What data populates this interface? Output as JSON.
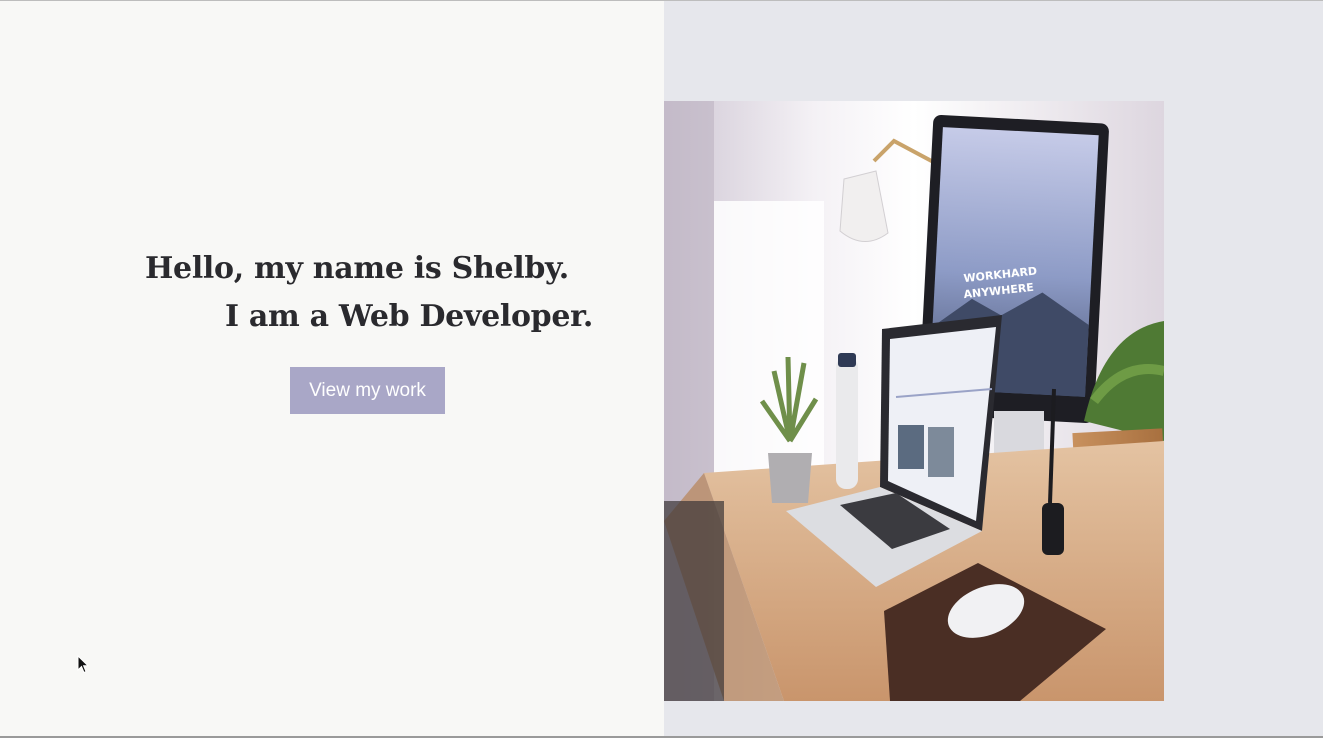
{
  "hero": {
    "greeting": "Hello, my name is Shelby.",
    "role": "I am a Web Developer.",
    "cta_label": "View my work"
  },
  "photo": {
    "monitor_text_line1": "WORKHARD",
    "monitor_text_line2": "ANYWHERE"
  },
  "colors": {
    "left_bg": "#f8f8f6",
    "right_bg": "#e6e7ec",
    "button_bg": "#a9a7c7",
    "text": "#2a2a2e"
  }
}
